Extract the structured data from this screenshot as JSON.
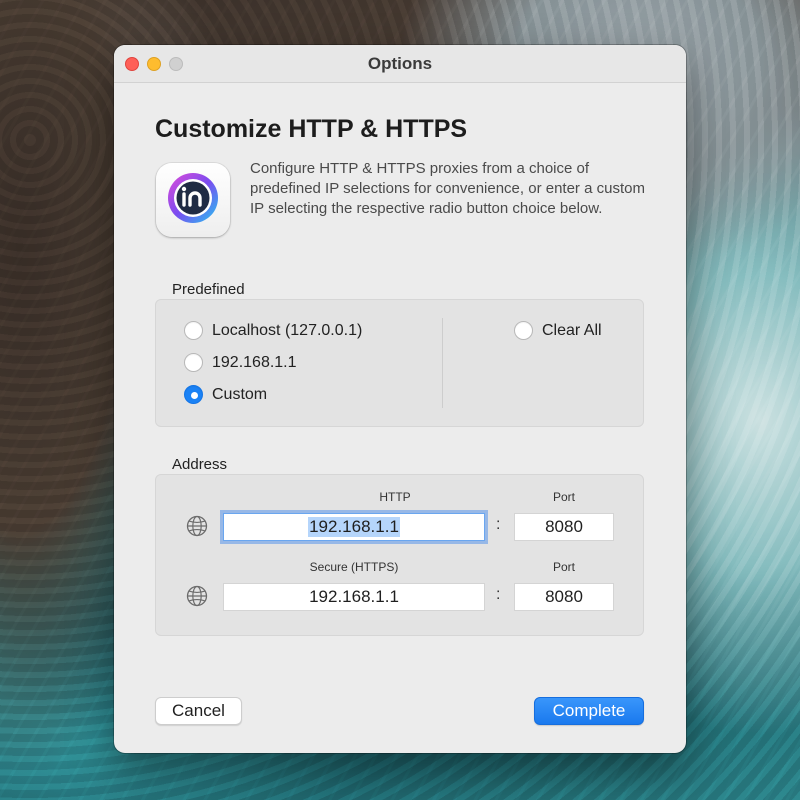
{
  "window": {
    "title": "Options"
  },
  "header": {
    "title": "Customize HTTP & HTTPS",
    "icon": "proxy-app-icon",
    "description": "Configure HTTP & HTTPS proxies from a choice of predefined IP selections for convenience, or enter a custom IP selecting the respective radio button choice below."
  },
  "predefined": {
    "label": "Predefined",
    "options": [
      {
        "label": "Localhost (127.0.0.1)",
        "checked": false
      },
      {
        "label": "192.168.1.1",
        "checked": false
      },
      {
        "label": "Custom",
        "checked": true
      }
    ],
    "clear_all": {
      "label": "Clear All",
      "checked": false
    }
  },
  "address": {
    "label": "Address",
    "http": {
      "header": "HTTP",
      "value": "192.168.1.1",
      "port_header": "Port",
      "port": "8080",
      "icon": "globe-icon"
    },
    "https": {
      "header": "Secure (HTTPS)",
      "value": "192.168.1.1",
      "port_header": "Port",
      "port": "8080",
      "icon": "globe-icon"
    },
    "separator": ":"
  },
  "buttons": {
    "cancel": "Cancel",
    "complete": "Complete"
  },
  "colors": {
    "accent": "#1b82f5",
    "close": "#fe5f57",
    "minimize": "#febc2e"
  }
}
